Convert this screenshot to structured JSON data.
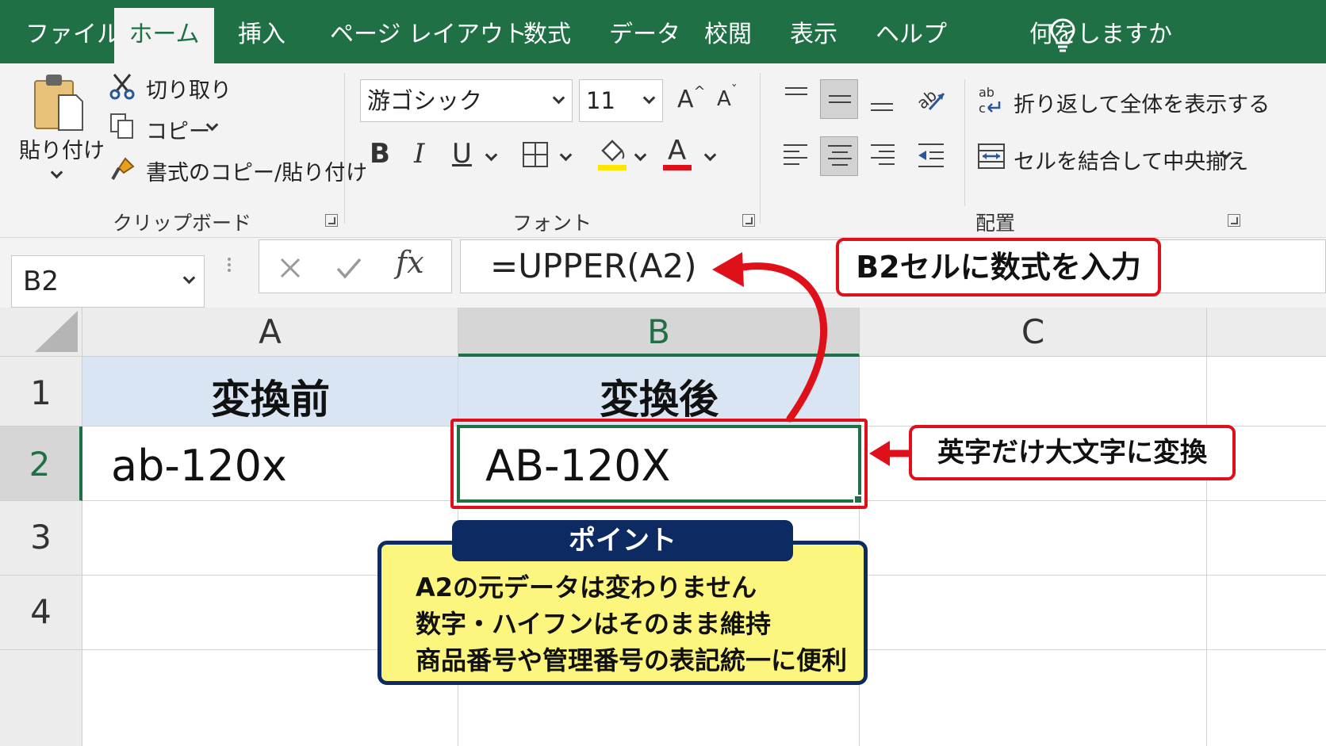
{
  "tabs": {
    "file": "ファイル",
    "home": "ホーム",
    "insert": "挿入",
    "page_layout": "ページ レイアウト",
    "formulas": "数式",
    "data": "データ",
    "review": "校閲",
    "view": "表示",
    "help": "ヘルプ",
    "tell_me": "何をしますか"
  },
  "ribbon": {
    "clipboard": {
      "paste": "貼り付け",
      "cut": "切り取り",
      "copy": "コピー",
      "format_painter": "書式のコピー/貼り付け",
      "label": "クリップボード"
    },
    "font": {
      "font_name": "游ゴシック",
      "font_size": "11",
      "grow": "A",
      "shrink": "A",
      "bold": "B",
      "italic": "I",
      "underline": "U",
      "font_color_letter": "A",
      "label": "フォント"
    },
    "alignment": {
      "wrap_text": "折り返して全体を表示する",
      "merge_center": "セルを結合して中央揃え",
      "label": "配置"
    }
  },
  "formula_bar": {
    "name_box": "B2",
    "fx": "fx",
    "formula": "=UPPER(A2)"
  },
  "sheet": {
    "columns": [
      "A",
      "B",
      "C"
    ],
    "rows": [
      "1",
      "2",
      "3",
      "4"
    ],
    "cells": {
      "A1": "変換前",
      "B1": "変換後",
      "A2": "ab-120x",
      "B2": "AB-120X"
    }
  },
  "annotations": {
    "formula_callout": "B2セルに数式を入力",
    "result_callout": "英字だけ大文字に変換",
    "point": {
      "title": "ポイント",
      "lines": [
        "A2の元データは変わりません",
        "数字・ハイフンはそのまま維持",
        "商品番号や管理番号の表記統一に便利"
      ]
    }
  },
  "colors": {
    "excel_green": "#1f7145",
    "header_fill": "#dae5f3",
    "callout_red": "#e0101a",
    "point_navy": "#0d2a63",
    "point_yellow": "#fdf67e",
    "highlight_yellow": "#ffe600",
    "font_red": "#e0101a"
  }
}
